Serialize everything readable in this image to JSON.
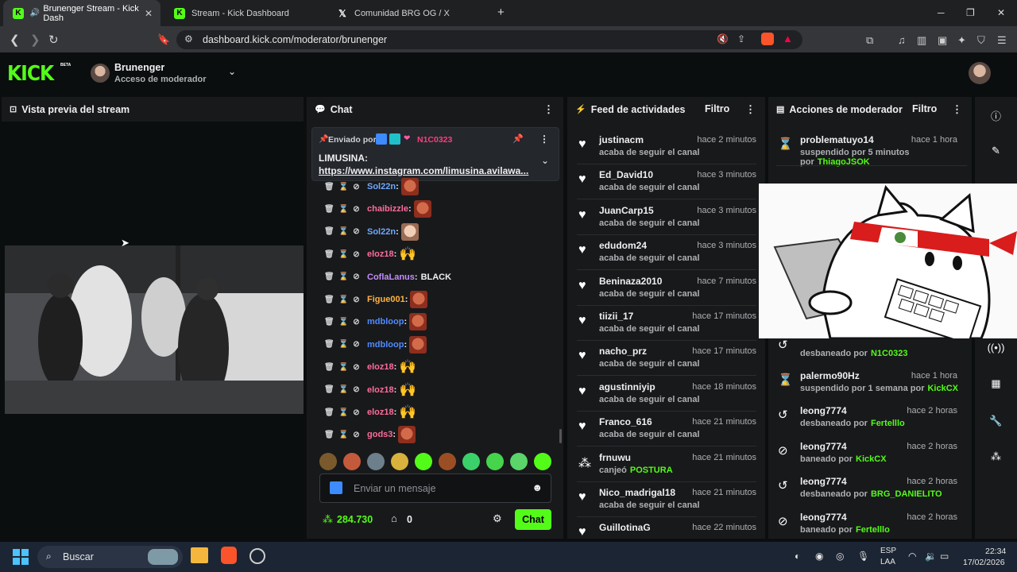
{
  "browser": {
    "tabs": [
      {
        "title": "Brunenger Stream - Kick Dash"
      },
      {
        "title": "Stream - Kick Dashboard"
      },
      {
        "title": "Comunidad BRG OG / X"
      }
    ],
    "url": "dashboard.kick.com/moderator/brunenger"
  },
  "header": {
    "logo": "KICK",
    "beta": "BETA",
    "channel": "Brunenger",
    "role": "Acceso de moderador"
  },
  "preview": {
    "title": "Vista previa del stream"
  },
  "chat": {
    "title": "Chat",
    "pinned": {
      "sent_by": "Enviado por",
      "author": "N1C0323",
      "line1": "LIMUSINA:",
      "link": "https://www.instagram.com/limusina.avilawa..."
    },
    "messages": [
      {
        "user": "Sol22n",
        "color": "#6fa8ff",
        "emote": "face"
      },
      {
        "user": "chaibizzle",
        "color": "#ff6b9a",
        "emote": "face"
      },
      {
        "user": "Sol22n",
        "color": "#6fa8ff",
        "emote": "light"
      },
      {
        "user": "eloz18",
        "color": "#ff6b9a",
        "emote": "hand"
      },
      {
        "user": "CoflaLanus",
        "color": "#c58cff",
        "text": "BLACK"
      },
      {
        "user": "Figue001",
        "color": "#ffb340",
        "emote": "face"
      },
      {
        "user": "mdbloop",
        "color": "#4f8bff",
        "emote": "face"
      },
      {
        "user": "mdbloop",
        "color": "#4f8bff",
        "emote": "face"
      },
      {
        "user": "eloz18",
        "color": "#ff6b9a",
        "emote": "hand"
      },
      {
        "user": "eloz18",
        "color": "#ff6b9a",
        "emote": "hand"
      },
      {
        "user": "eloz18",
        "color": "#ff6b9a",
        "emote": "hand"
      },
      {
        "user": "gods3",
        "color": "#ff6b9a",
        "emote": "face"
      }
    ],
    "input_placeholder": "Enviar un mensaje",
    "points": "284.730",
    "store_count": "0",
    "send_label": "Chat"
  },
  "activity": {
    "title": "Feed de actividades",
    "filter": "Filtro",
    "items": [
      {
        "icon": "heart",
        "user": "justinacm",
        "text": "acaba de seguir el canal",
        "time": "hace 2 minutos"
      },
      {
        "icon": "heart",
        "user": "Ed_David10",
        "text": "acaba de seguir el canal",
        "time": "hace 3 minutos"
      },
      {
        "icon": "heart",
        "user": "JuanCarp15",
        "text": "acaba de seguir el canal",
        "time": "hace 3 minutos"
      },
      {
        "icon": "heart",
        "user": "edudom24",
        "text": "acaba de seguir el canal",
        "time": "hace 3 minutos"
      },
      {
        "icon": "heart",
        "user": "Beninaza2010",
        "text": "acaba de seguir el canal",
        "time": "hace 7 minutos"
      },
      {
        "icon": "heart",
        "user": "tiizii_17",
        "text": "acaba de seguir el canal",
        "time": "hace 17 minutos"
      },
      {
        "icon": "heart",
        "user": "nacho_prz",
        "text": "acaba de seguir el canal",
        "time": "hace 17 minutos"
      },
      {
        "icon": "heart",
        "user": "agustinniyip",
        "text": "acaba de seguir el canal",
        "time": "hace 18 minutos"
      },
      {
        "icon": "heart",
        "user": "Franco_616",
        "text": "acaba de seguir el canal",
        "time": "hace 21 minutos"
      },
      {
        "icon": "points",
        "user": "frnuwu",
        "text": "canjeó",
        "highlight": "POSTURA",
        "time": "hace 21 minutos"
      },
      {
        "icon": "heart",
        "user": "Nico_madrigal18",
        "text": "acaba de seguir el canal",
        "time": "hace 21 minutos"
      },
      {
        "icon": "heart",
        "user": "GuillotinaG",
        "text": "",
        "time": "hace 22 minutos"
      }
    ]
  },
  "modactions": {
    "title": "Acciones de moderador",
    "filter": "Filtro",
    "items": [
      {
        "icon": "timeout",
        "user": "problematuyo14",
        "text": "suspendido por 5 minutos por",
        "by": "ThiagoJSOK",
        "time": "hace 1 hora"
      },
      {
        "icon": "unban",
        "user": "",
        "text": "desbaneado por",
        "by": "N1C0323",
        "time": ""
      },
      {
        "icon": "timeout",
        "user": "palermo90Hz",
        "text": "suspendido por 1 semana por",
        "by": "KickCX",
        "time": "hace 1 hora"
      },
      {
        "icon": "unban",
        "user": "leong7774",
        "text": "desbaneado por",
        "by": "Fertelllo",
        "time": "hace 2 horas"
      },
      {
        "icon": "ban",
        "user": "leong7774",
        "text": "baneado por",
        "by": "KickCX",
        "time": "hace 2 horas"
      },
      {
        "icon": "unban",
        "user": "leong7774",
        "text": "desbaneado por",
        "by": "BRG_DANIELITO",
        "time": "hace 2 horas"
      },
      {
        "icon": "ban",
        "user": "leong7774",
        "text": "baneado por",
        "by": "Fertelllo",
        "time": "hace 2 horas"
      }
    ]
  },
  "taskbar": {
    "search": "Buscar",
    "lang1": "ESP",
    "lang2": "LAA",
    "time": "22:34",
    "date": "17/02/2026"
  },
  "colors": {
    "accent": "#53fc18",
    "panel": "#18191b",
    "bg": "#0b0e0f"
  }
}
